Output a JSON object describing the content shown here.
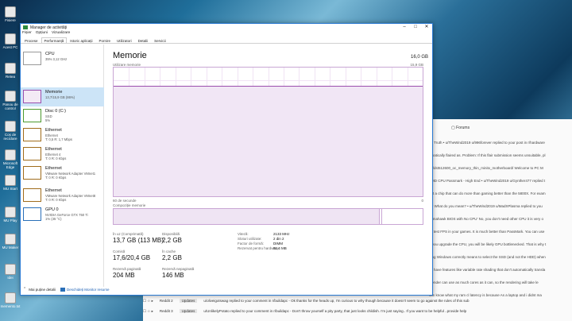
{
  "desktop": {
    "icons": [
      {
        "label": "Fisiere",
        "icon": "folder-icon"
      },
      {
        "label": "Acest PC",
        "icon": "computer-icon"
      },
      {
        "label": "Retea",
        "icon": "network-icon"
      },
      {
        "label": "Panou de control",
        "icon": "control-panel-icon"
      },
      {
        "label": "Coș de reciclare",
        "icon": "recycle-bin-icon"
      },
      {
        "label": "Microsoft Edge",
        "icon": "edge-icon"
      },
      {
        "label": "MU Start",
        "icon": "mu-start-icon"
      },
      {
        "label": "MU Play",
        "icon": "mu-play-icon"
      },
      {
        "label": "MU Maker",
        "icon": "mu-maker-icon"
      },
      {
        "label": "Idei",
        "icon": "file-icon"
      },
      {
        "label": "memento.txt",
        "icon": "text-file-icon"
      }
    ]
  },
  "browser_bg": {
    "forums": "Forums",
    "lines": [
      "he Truth • u/TheWind2019 u/996forever replied to your post in r/hardware",
      "omatically flaired as. Problem: If this flair submission seems unsuitable, pl",
      "y9/dst512600_oc_memory_thin_minitx_motherboard/ Welcome to PC M",
      "AMD CPU Passmark - High End • u/TheWind2019 u/Gynther477 replied t",
      "get a chip that can do more than gaming better than the 5800X. For exam",
      "e • What do you mean? • u/TheWind2019 u/MadXPlasma replied to you",
      "Tomahawk BIOS with No CPU' No, you don't need other CPU it is very o",
      "ist test FPS in your games. It is much better than PassMark. You can use",
      "If you upgrade the CPU, you will be likely GPU bottlenecked. That is why t",
      "ding Windows correctly means to select the SSD (and not the HDD) when",
      "es have features like variable rate shading that don't automatically transla",
      "blender can use as much cores as it can, so the rendering will take le",
      "can know what my ram cl latency is because As a laptop and i didnt ma"
    ],
    "rows": [
      {
        "source": "Reddit 2",
        "tag": "Updates",
        "text": "u/oliveigotswag replied to your comment in r/buildapc - Ok thanks for the heads up, I'm curious to why though because it doesn't seem to go against the rules of this sub"
      },
      {
        "source": "Reddit 3",
        "tag": "Updates",
        "text": "u/UnlikelyPotato replied to your comment in r/buildapc - Don't throw yourself a pity party, that just looks childish. I'm just saying.. If you want to be helpful ..provide help"
      }
    ]
  },
  "window": {
    "title": "Manager de activități",
    "menu": [
      "Fișier",
      "Opțiuni",
      "Vizualizare"
    ],
    "tabs": [
      "Procese",
      "Performanță",
      "Istoric aplicații",
      "Pornire",
      "Utilizatori",
      "Detalii",
      "Servicii"
    ],
    "active_tab": "Performanță"
  },
  "sidebar": [
    {
      "name": "CPU",
      "line1": "35% 3,12 GHz",
      "line2": "",
      "kind": "cpu"
    },
    {
      "name": "Memorie",
      "line1": "13,7/15,9 GB (86%)",
      "line2": "",
      "kind": "mem",
      "selected": true
    },
    {
      "name": "Disc 0 (C:)",
      "line1": "SSD",
      "line2": "5%",
      "kind": "disk"
    },
    {
      "name": "Ethernet",
      "line1": "Ethernet",
      "line2": "T: 0,5 R: 1,7 Mbps",
      "kind": "eth"
    },
    {
      "name": "Ethernet",
      "line1": "Ethernet 4",
      "line2": "T: 0 R: 0 Kbps",
      "kind": "eth"
    },
    {
      "name": "Ethernet",
      "line1": "VMware Network Adapter VMnet1",
      "line2": "T: 0 R: 0 Kbps",
      "kind": "eth"
    },
    {
      "name": "Ethernet",
      "line1": "VMware Network Adapter VMnet8",
      "line2": "T: 0 R: 0 Kbps",
      "kind": "eth"
    },
    {
      "name": "GPU 0",
      "line1": "NVIDIA GeForce GTX 750 Ti",
      "line2": "1% (35 °C)",
      "kind": "gpu"
    }
  ],
  "main": {
    "heading": "Memorie",
    "capacity": "16,0 GB",
    "usage_label": "Utilizare memorie",
    "usage_max": "15,9 GB",
    "seconds_label": "60 de secunde",
    "zero_label": "0",
    "composition_label": "Compoziție memorie",
    "usage_fraction": 0.86,
    "composition": {
      "in_use": 0.86,
      "modified": 0.01
    },
    "stats": {
      "in_use_label": "În uz (Comprimată)",
      "in_use_value": "13,7 GB (113 MB)",
      "available_label": "Disponibilă",
      "available_value": "2,2 GB",
      "committed_label": "Comisă",
      "committed_value": "17,6/20,4 GB",
      "cached_label": "În cache",
      "cached_value": "2,2 GB",
      "paged_label": "Rezervă paginată",
      "paged_value": "204 MB",
      "nonpaged_label": "Rezervă nepaginată",
      "nonpaged_value": "146 MB"
    },
    "details": [
      {
        "k": "Viteză:",
        "v": "2133 MHz"
      },
      {
        "k": "Sloturi utilizate:",
        "v": "2 din 2"
      },
      {
        "k": "Factor de formă:",
        "v": "DIMM"
      },
      {
        "k": "Rezervat pentru hardware:",
        "v": "51,4 MB"
      }
    ]
  },
  "footer": {
    "fewer_details": "Mai puține detalii",
    "resource_monitor": "Deschideți Monitor resurse"
  }
}
